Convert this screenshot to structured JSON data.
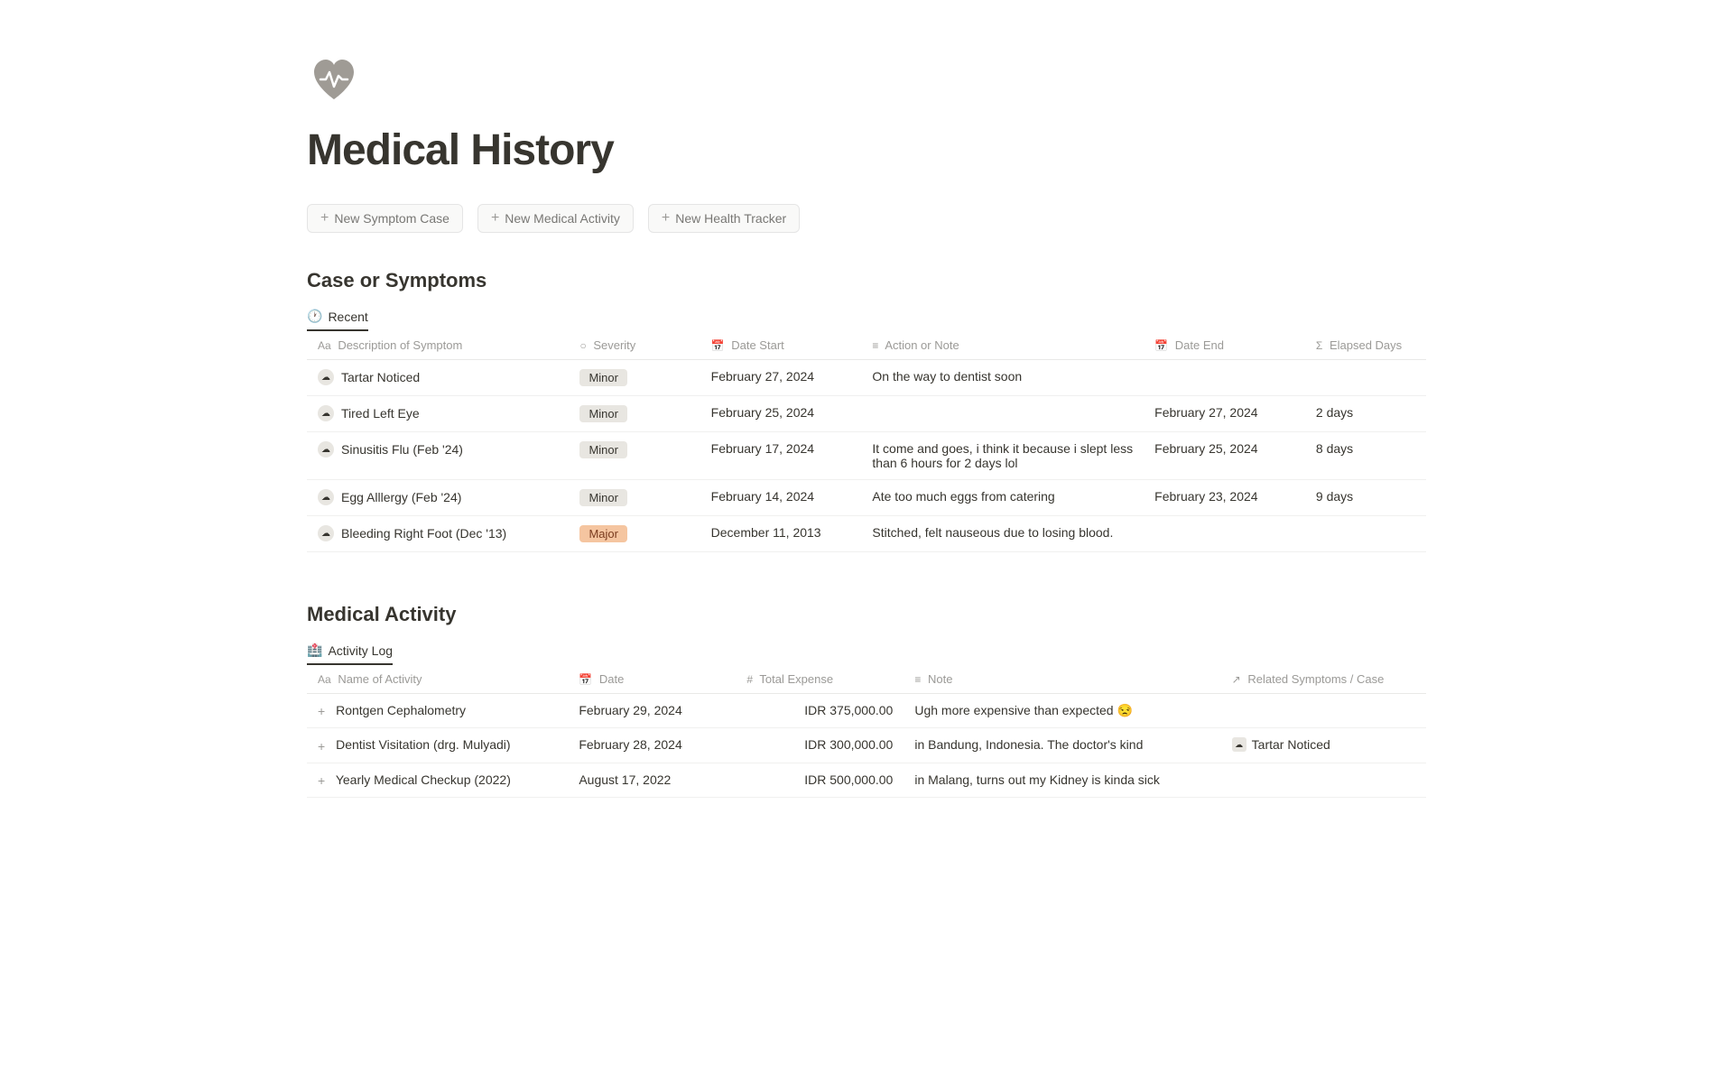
{
  "page": {
    "title": "Medical History",
    "logo_alt": "medical-history-logo"
  },
  "actions": {
    "new_symptom_label": "New Symptom Case",
    "new_activity_label": "New Medical Activity",
    "new_tracker_label": "New Health Tracker"
  },
  "symptoms_section": {
    "title": "Case or Symptoms",
    "tab_label": "Recent",
    "columns": {
      "description": "Description of Symptom",
      "severity": "Severity",
      "date_start": "Date Start",
      "action_note": "Action or Note",
      "date_end": "Date End",
      "elapsed_days": "Elapsed Days"
    },
    "rows": [
      {
        "description": "Tartar Noticed",
        "severity": "Minor",
        "severity_type": "minor",
        "date_start": "February 27, 2024",
        "action_note": "On the way to dentist soon",
        "date_end": "",
        "elapsed_days": ""
      },
      {
        "description": "Tired Left Eye",
        "severity": "Minor",
        "severity_type": "minor",
        "date_start": "February 25, 2024",
        "action_note": "",
        "date_end": "February 27, 2024",
        "elapsed_days": "2 days"
      },
      {
        "description": "Sinusitis Flu (Feb '24)",
        "severity": "Minor",
        "severity_type": "minor",
        "date_start": "February 17, 2024",
        "action_note": "It come and goes, i think it because i slept less than 6 hours for 2 days lol",
        "date_end": "February 25, 2024",
        "elapsed_days": "8 days"
      },
      {
        "description": "Egg Alllergy (Feb '24)",
        "severity": "Minor",
        "severity_type": "minor",
        "date_start": "February 14, 2024",
        "action_note": "Ate too much eggs from catering",
        "date_end": "February 23, 2024",
        "elapsed_days": "9 days"
      },
      {
        "description": "Bleeding Right Foot (Dec '13)",
        "severity": "Major",
        "severity_type": "major",
        "date_start": "December 11, 2013",
        "action_note": "Stitched, felt nauseous due to losing blood.",
        "date_end": "",
        "elapsed_days": ""
      }
    ]
  },
  "activity_section": {
    "title": "Medical Activity",
    "tab_label": "Activity Log",
    "columns": {
      "name": "Name of Activity",
      "date": "Date",
      "expense": "Total Expense",
      "note": "Note",
      "related": "Related Symptoms / Case"
    },
    "rows": [
      {
        "name": "Rontgen Cephalometry",
        "date": "February 29, 2024",
        "expense": "IDR 375,000.00",
        "note": "Ugh more expensive than expected 😒",
        "related": ""
      },
      {
        "name": "Dentist Visitation (drg. Mulyadi)",
        "date": "February 28, 2024",
        "expense": "IDR 300,000.00",
        "note": "in Bandung, Indonesia. The doctor's kind",
        "related": "Tartar Noticed"
      },
      {
        "name": "Yearly Medical Checkup (2022)",
        "date": "August 17, 2022",
        "expense": "IDR 500,000.00",
        "note": "in Malang, turns out my Kidney is kinda sick",
        "related": ""
      }
    ]
  }
}
